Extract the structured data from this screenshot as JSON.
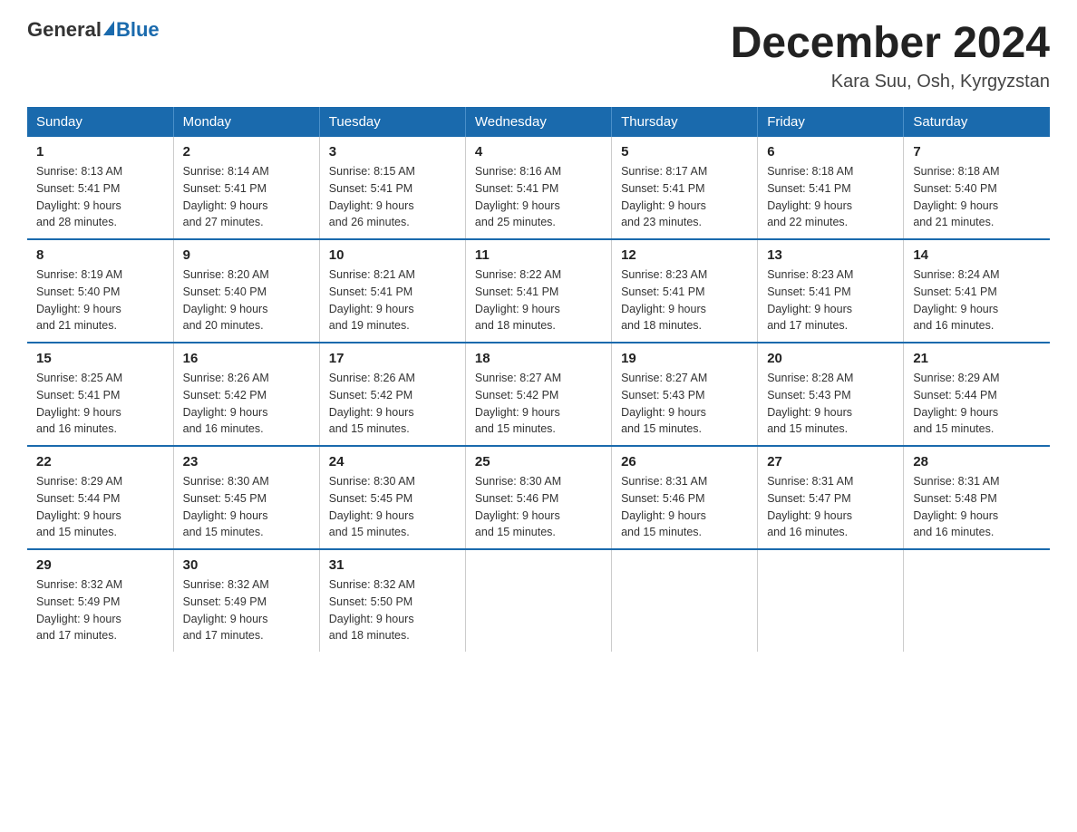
{
  "header": {
    "logo_general": "General",
    "logo_blue": "Blue",
    "month_title": "December 2024",
    "location": "Kara Suu, Osh, Kyrgyzstan"
  },
  "days_of_week": [
    "Sunday",
    "Monday",
    "Tuesday",
    "Wednesday",
    "Thursday",
    "Friday",
    "Saturday"
  ],
  "weeks": [
    [
      {
        "day": "1",
        "sunrise": "8:13 AM",
        "sunset": "5:41 PM",
        "daylight_hours": "9 hours",
        "daylight_minutes": "and 28 minutes."
      },
      {
        "day": "2",
        "sunrise": "8:14 AM",
        "sunset": "5:41 PM",
        "daylight_hours": "9 hours",
        "daylight_minutes": "and 27 minutes."
      },
      {
        "day": "3",
        "sunrise": "8:15 AM",
        "sunset": "5:41 PM",
        "daylight_hours": "9 hours",
        "daylight_minutes": "and 26 minutes."
      },
      {
        "day": "4",
        "sunrise": "8:16 AM",
        "sunset": "5:41 PM",
        "daylight_hours": "9 hours",
        "daylight_minutes": "and 25 minutes."
      },
      {
        "day": "5",
        "sunrise": "8:17 AM",
        "sunset": "5:41 PM",
        "daylight_hours": "9 hours",
        "daylight_minutes": "and 23 minutes."
      },
      {
        "day": "6",
        "sunrise": "8:18 AM",
        "sunset": "5:41 PM",
        "daylight_hours": "9 hours",
        "daylight_minutes": "and 22 minutes."
      },
      {
        "day": "7",
        "sunrise": "8:18 AM",
        "sunset": "5:40 PM",
        "daylight_hours": "9 hours",
        "daylight_minutes": "and 21 minutes."
      }
    ],
    [
      {
        "day": "8",
        "sunrise": "8:19 AM",
        "sunset": "5:40 PM",
        "daylight_hours": "9 hours",
        "daylight_minutes": "and 21 minutes."
      },
      {
        "day": "9",
        "sunrise": "8:20 AM",
        "sunset": "5:40 PM",
        "daylight_hours": "9 hours",
        "daylight_minutes": "and 20 minutes."
      },
      {
        "day": "10",
        "sunrise": "8:21 AM",
        "sunset": "5:41 PM",
        "daylight_hours": "9 hours",
        "daylight_minutes": "and 19 minutes."
      },
      {
        "day": "11",
        "sunrise": "8:22 AM",
        "sunset": "5:41 PM",
        "daylight_hours": "9 hours",
        "daylight_minutes": "and 18 minutes."
      },
      {
        "day": "12",
        "sunrise": "8:23 AM",
        "sunset": "5:41 PM",
        "daylight_hours": "9 hours",
        "daylight_minutes": "and 18 minutes."
      },
      {
        "day": "13",
        "sunrise": "8:23 AM",
        "sunset": "5:41 PM",
        "daylight_hours": "9 hours",
        "daylight_minutes": "and 17 minutes."
      },
      {
        "day": "14",
        "sunrise": "8:24 AM",
        "sunset": "5:41 PM",
        "daylight_hours": "9 hours",
        "daylight_minutes": "and 16 minutes."
      }
    ],
    [
      {
        "day": "15",
        "sunrise": "8:25 AM",
        "sunset": "5:41 PM",
        "daylight_hours": "9 hours",
        "daylight_minutes": "and 16 minutes."
      },
      {
        "day": "16",
        "sunrise": "8:26 AM",
        "sunset": "5:42 PM",
        "daylight_hours": "9 hours",
        "daylight_minutes": "and 16 minutes."
      },
      {
        "day": "17",
        "sunrise": "8:26 AM",
        "sunset": "5:42 PM",
        "daylight_hours": "9 hours",
        "daylight_minutes": "and 15 minutes."
      },
      {
        "day": "18",
        "sunrise": "8:27 AM",
        "sunset": "5:42 PM",
        "daylight_hours": "9 hours",
        "daylight_minutes": "and 15 minutes."
      },
      {
        "day": "19",
        "sunrise": "8:27 AM",
        "sunset": "5:43 PM",
        "daylight_hours": "9 hours",
        "daylight_minutes": "and 15 minutes."
      },
      {
        "day": "20",
        "sunrise": "8:28 AM",
        "sunset": "5:43 PM",
        "daylight_hours": "9 hours",
        "daylight_minutes": "and 15 minutes."
      },
      {
        "day": "21",
        "sunrise": "8:29 AM",
        "sunset": "5:44 PM",
        "daylight_hours": "9 hours",
        "daylight_minutes": "and 15 minutes."
      }
    ],
    [
      {
        "day": "22",
        "sunrise": "8:29 AM",
        "sunset": "5:44 PM",
        "daylight_hours": "9 hours",
        "daylight_minutes": "and 15 minutes."
      },
      {
        "day": "23",
        "sunrise": "8:30 AM",
        "sunset": "5:45 PM",
        "daylight_hours": "9 hours",
        "daylight_minutes": "and 15 minutes."
      },
      {
        "day": "24",
        "sunrise": "8:30 AM",
        "sunset": "5:45 PM",
        "daylight_hours": "9 hours",
        "daylight_minutes": "and 15 minutes."
      },
      {
        "day": "25",
        "sunrise": "8:30 AM",
        "sunset": "5:46 PM",
        "daylight_hours": "9 hours",
        "daylight_minutes": "and 15 minutes."
      },
      {
        "day": "26",
        "sunrise": "8:31 AM",
        "sunset": "5:46 PM",
        "daylight_hours": "9 hours",
        "daylight_minutes": "and 15 minutes."
      },
      {
        "day": "27",
        "sunrise": "8:31 AM",
        "sunset": "5:47 PM",
        "daylight_hours": "9 hours",
        "daylight_minutes": "and 16 minutes."
      },
      {
        "day": "28",
        "sunrise": "8:31 AM",
        "sunset": "5:48 PM",
        "daylight_hours": "9 hours",
        "daylight_minutes": "and 16 minutes."
      }
    ],
    [
      {
        "day": "29",
        "sunrise": "8:32 AM",
        "sunset": "5:49 PM",
        "daylight_hours": "9 hours",
        "daylight_minutes": "and 17 minutes."
      },
      {
        "day": "30",
        "sunrise": "8:32 AM",
        "sunset": "5:49 PM",
        "daylight_hours": "9 hours",
        "daylight_minutes": "and 17 minutes."
      },
      {
        "day": "31",
        "sunrise": "8:32 AM",
        "sunset": "5:50 PM",
        "daylight_hours": "9 hours",
        "daylight_minutes": "and 18 minutes."
      },
      null,
      null,
      null,
      null
    ]
  ]
}
